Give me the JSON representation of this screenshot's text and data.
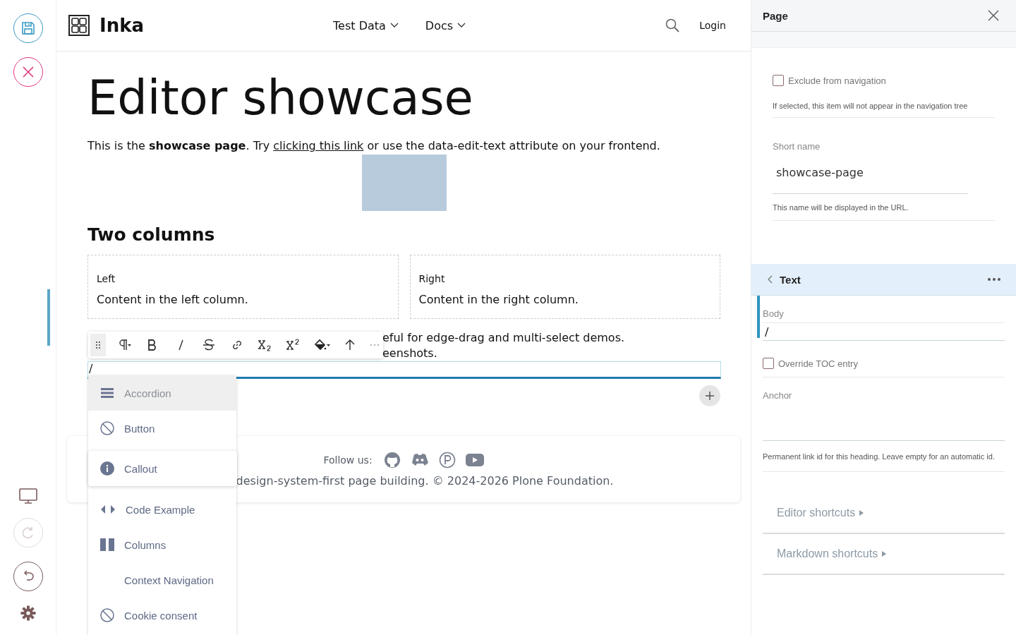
{
  "rail": {
    "top": [
      {
        "kind": "save"
      },
      {
        "kind": "cancel"
      }
    ],
    "bottom": [
      {
        "kind": "display",
        "disabled": false
      },
      {
        "kind": "redo",
        "disabled": true
      },
      {
        "kind": "undo",
        "disabled": false
      },
      {
        "kind": "settings",
        "disabled": false
      }
    ]
  },
  "header": {
    "logo": "Inka",
    "nav": [
      {
        "label": "Test Data"
      },
      {
        "label": "Docs"
      }
    ],
    "login": "Login"
  },
  "content": {
    "title": "Editor showcase",
    "intro_before": "This is the **showcase page**. Try ",
    "intro_link": "clicking this link",
    "intro_after": " or use the data-edit-text attribute on your frontend.",
    "section_title": "Two columns",
    "columns": [
      {
        "label": "Left",
        "text": "Content in the left column."
      },
      {
        "label": "Right",
        "text": "Content in the right column."
      }
    ],
    "partial_lines": [
      "eful for edge-drag and multi-select demos.",
      "eenshots."
    ],
    "active_block": {
      "text": "/"
    }
  },
  "format_toolbar": [
    {
      "kind": "drag"
    },
    {
      "kind": "paragraph"
    },
    {
      "kind": "bold"
    },
    {
      "kind": "italic"
    },
    {
      "kind": "strike"
    },
    {
      "kind": "link"
    },
    {
      "kind": "subscript"
    },
    {
      "kind": "superscript"
    },
    {
      "kind": "color"
    },
    {
      "kind": "up"
    },
    {
      "kind": "more"
    }
  ],
  "block_menu": [
    {
      "label": "Accordion",
      "kind": "bars",
      "selected": true,
      "hovered": false
    },
    {
      "label": "Button",
      "kind": "ban",
      "selected": false,
      "hovered": false
    },
    {
      "label": "Callout",
      "kind": "info",
      "selected": false,
      "hovered": true
    },
    {
      "label": "Code Example",
      "kind": "code",
      "selected": false,
      "hovered": false
    },
    {
      "label": "Columns",
      "kind": "columns",
      "selected": false,
      "hovered": false
    },
    {
      "label": "Context Navigation",
      "kind": "plain",
      "selected": false,
      "hovered": false
    },
    {
      "label": "Cookie consent",
      "kind": "ban",
      "selected": false,
      "hovered": false
    }
  ],
  "footer": {
    "follow": "Follow us:",
    "social": [
      {
        "kind": "github"
      },
      {
        "kind": "discord"
      },
      {
        "kind": "patreon"
      },
      {
        "kind": "youtube"
      }
    ],
    "copyright": "design-system-first page building. © 2024-2026 Plone Foundation."
  },
  "sidebar": {
    "title": "Page",
    "exclude": {
      "label": "Exclude from navigation",
      "checked": false,
      "help": "If selected, this item will not appear in the navigation tree"
    },
    "short_name": {
      "label": "Short name",
      "value": "showcase-page",
      "help": "This name will be displayed in the URL."
    },
    "block": {
      "title": "Text",
      "body_label": "Body",
      "body_value": "/",
      "toc": {
        "label": "Override TOC entry",
        "checked": false
      },
      "anchor_label": "Anchor",
      "anchor_help": "Permanent link id for this heading. Leave empty for an automatic id."
    },
    "shortcuts": [
      {
        "label": "Editor shortcuts",
        "expanded": false
      },
      {
        "label": "Markdown shortcuts",
        "expanded": false
      }
    ]
  }
}
